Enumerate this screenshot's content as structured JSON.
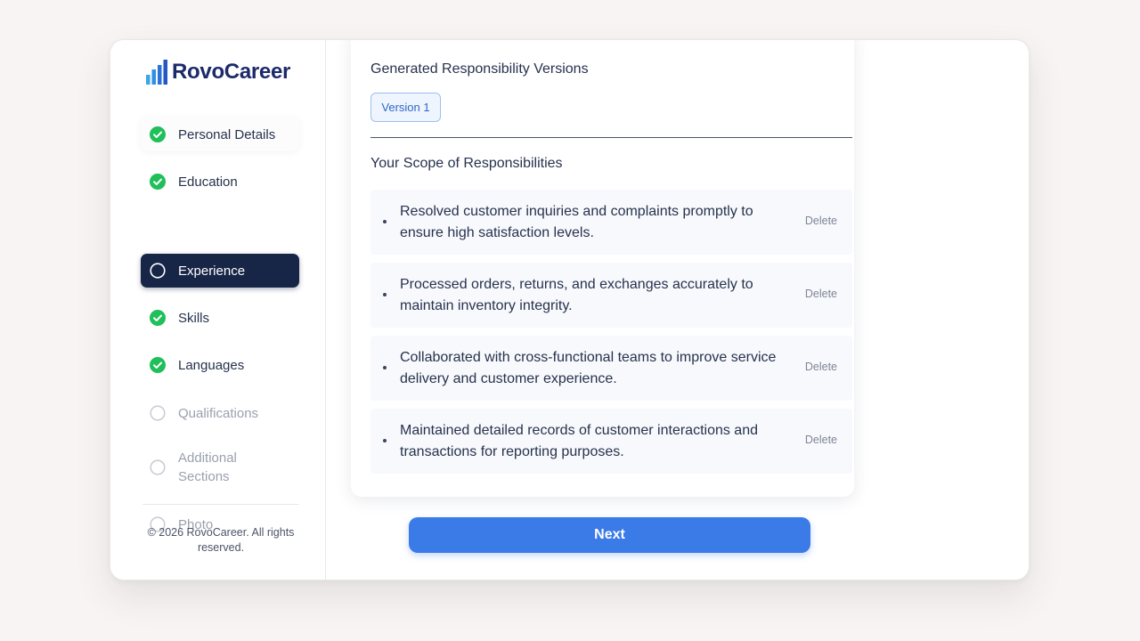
{
  "brand": {
    "name": "RovoCareer"
  },
  "sidebar": {
    "steps": [
      {
        "label": "Personal Details",
        "status": "complete"
      },
      {
        "label": "Education",
        "status": "complete"
      },
      {
        "label": "Experience",
        "status": "active"
      },
      {
        "label": "Skills",
        "status": "complete"
      },
      {
        "label": "Languages",
        "status": "complete"
      },
      {
        "label": "Qualifications",
        "status": "pending"
      },
      {
        "label": "Additional Sections",
        "status": "pending"
      },
      {
        "label": "Photo",
        "status": "pending"
      }
    ],
    "copyright": "© 2026 RovoCareer. All rights reserved."
  },
  "main": {
    "generated_title": "Generated Responsibility Versions",
    "versions": [
      {
        "label": "Version 1",
        "selected": true
      }
    ],
    "scope_title": "Your Scope of Responsibilities",
    "responsibilities": [
      {
        "text": "Resolved customer inquiries and complaints promptly to ensure high satisfaction levels.",
        "action": "Delete"
      },
      {
        "text": "Processed orders, returns, and exchanges accurately to maintain inventory integrity.",
        "action": "Delete"
      },
      {
        "text": "Collaborated with cross-functional teams to improve service delivery and customer experience.",
        "action": "Delete"
      },
      {
        "text": "Maintained detailed records of customer interactions and transactions for reporting purposes.",
        "action": "Delete"
      }
    ],
    "next_label": "Next"
  },
  "icons": {
    "complete": "check-circle-icon",
    "active": "circle-outline-icon",
    "pending": "circle-outline-icon",
    "logo": "bar-chart-logo-icon"
  },
  "colors": {
    "accent": "#3b7be8",
    "active_step": "#172647",
    "complete": "#1fbf5a",
    "brand_text": "#1b2a6b",
    "version_chip": "#2f67c8"
  }
}
